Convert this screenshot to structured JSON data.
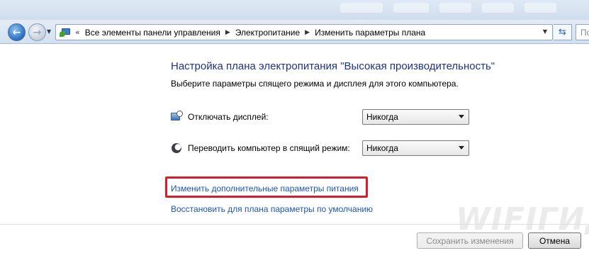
{
  "address_bar": {
    "overflow_chevron": "«",
    "breadcrumbs": [
      "Все элементы панели управления",
      "Электропитание",
      "Изменить параметры плана"
    ],
    "search_placeholder": "По"
  },
  "page": {
    "title": "Настройка плана электропитания \"Высокая производительность\"",
    "subtitle": "Выберите параметры спящего режима и дисплея для этого компьютера."
  },
  "settings": {
    "display_off": {
      "label": "Отключать дисплей:",
      "value": "Никогда",
      "icon": "display-timer-icon"
    },
    "sleep": {
      "label": "Переводить компьютер в спящий режим:",
      "value": "Никогда",
      "icon": "sleep-moon-icon"
    }
  },
  "links": {
    "advanced": "Изменить дополнительные параметры питания",
    "restore": "Восстановить для плана параметры по умолчанию"
  },
  "highlight_color": "#d1202c",
  "watermark": "WIFIГИД",
  "buttons": {
    "save": "Сохранить изменения",
    "cancel": "Отмена"
  }
}
